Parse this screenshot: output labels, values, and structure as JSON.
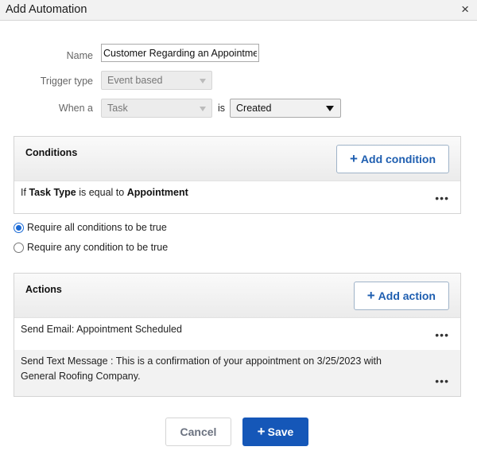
{
  "dialog": {
    "title": "Add Automation",
    "close_glyph": "×",
    "close_icon": "close-icon"
  },
  "form": {
    "name_label": "Name",
    "name_value": "Customer Regarding an Appointment",
    "trigger_label": "Trigger type",
    "trigger_value": "Event based",
    "when_label": "When a",
    "when_value": "Task",
    "is_label": "is",
    "state_value": "Created"
  },
  "conditions": {
    "title": "Conditions",
    "add_label": "Add condition",
    "items": [
      {
        "prefix": "If",
        "field": "Task Type",
        "op": "is equal to",
        "value": "Appointment"
      }
    ]
  },
  "match": {
    "options": [
      {
        "label": "Require all conditions to be true",
        "selected": true
      },
      {
        "label": "Require any condition to be true",
        "selected": false
      }
    ]
  },
  "actions": {
    "title": "Actions",
    "add_label": "Add action",
    "items": [
      {
        "text": "Send Email: Appointment Scheduled"
      },
      {
        "text": "Send Text Message : This is a confirmation of your appointment on 3/25/2023 with General Roofing Company."
      }
    ]
  },
  "footer": {
    "cancel_label": "Cancel",
    "save_label": "Save"
  },
  "glyphs": {
    "plus": "+",
    "more": "•••"
  },
  "colors": {
    "primary": "#1557b8",
    "link": "#1e5eb0",
    "radio": "#1a6ad6"
  }
}
